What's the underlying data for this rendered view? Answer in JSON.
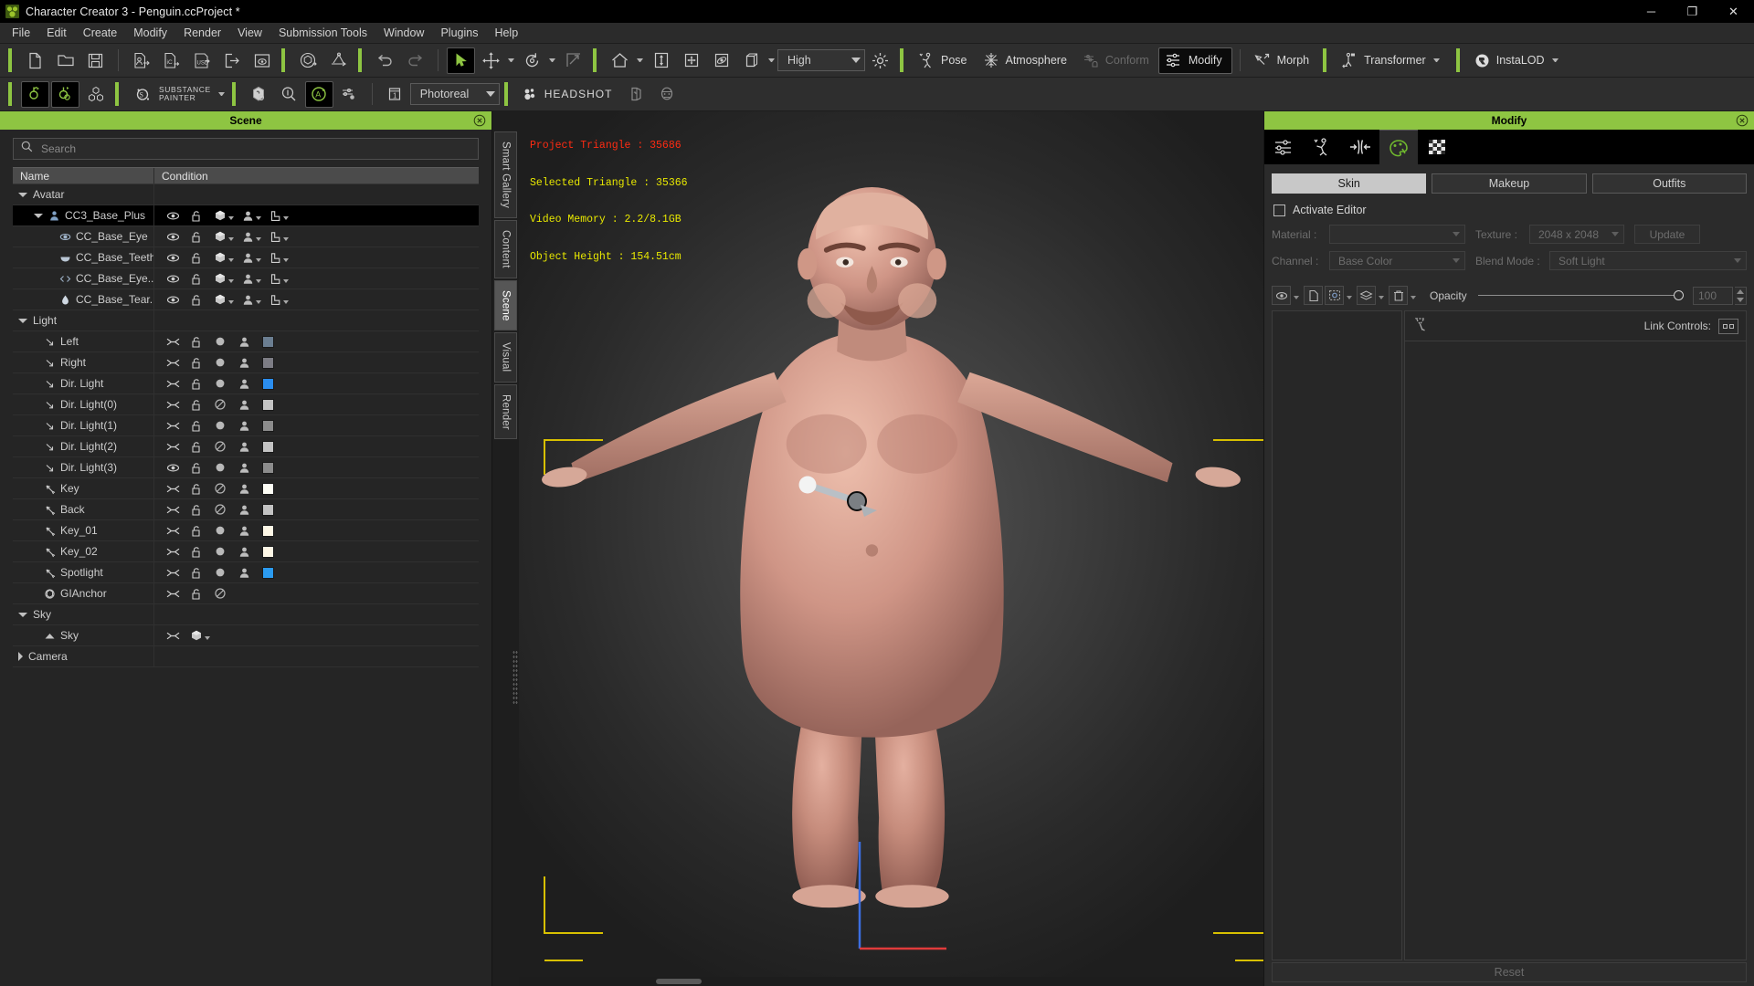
{
  "window": {
    "title": "Character Creator 3 - Penguin.ccProject *",
    "minimize": "─",
    "maximize": "❐",
    "close": "✕"
  },
  "menu": {
    "items": [
      {
        "label": "File"
      },
      {
        "label": "Edit"
      },
      {
        "label": "Create"
      },
      {
        "label": "Modify"
      },
      {
        "label": "Render"
      },
      {
        "label": "View"
      },
      {
        "label": "Submission Tools"
      },
      {
        "label": "Window"
      },
      {
        "label": "Plugins"
      },
      {
        "label": "Help"
      }
    ]
  },
  "toolbar_row1": {
    "quality_select": "High",
    "buttons": [
      {
        "name": "new-project",
        "label": "New Project"
      },
      {
        "name": "open-project",
        "label": "Open Project"
      },
      {
        "name": "save-project",
        "label": "Save Project"
      },
      {
        "name": "import-character",
        "label": "Import Character"
      },
      {
        "name": "import-iclone",
        "label": "Import iClone"
      },
      {
        "name": "import-usd",
        "label": "Import USD"
      },
      {
        "name": "export",
        "label": "Export"
      },
      {
        "name": "render-image",
        "label": "Render Image"
      },
      {
        "name": "reset-selected",
        "label": "Reset Selected"
      },
      {
        "name": "pivot-to-ground",
        "label": "Pivot To Ground"
      },
      {
        "name": "undo",
        "label": "Undo"
      },
      {
        "name": "redo",
        "label": "Redo"
      },
      {
        "name": "select-tool",
        "label": "Select"
      },
      {
        "name": "move-tool",
        "label": "Move"
      },
      {
        "name": "rotate-tool",
        "label": "Rotate"
      },
      {
        "name": "scale-tool",
        "label": "Scale"
      },
      {
        "name": "home-view",
        "label": "Home View"
      },
      {
        "name": "fit-vertical",
        "label": "Fit Vertical"
      },
      {
        "name": "fit-all",
        "label": "Fit All"
      },
      {
        "name": "orbit-view",
        "label": "Orbit View"
      },
      {
        "name": "shading-mode",
        "label": "Shading Mode"
      },
      {
        "name": "lighting-toggle",
        "label": "Lighting"
      }
    ],
    "mode_buttons": [
      {
        "name": "pose",
        "label": "Pose",
        "state": "normal"
      },
      {
        "name": "atmosphere",
        "label": "Atmosphere",
        "state": "normal"
      },
      {
        "name": "conform",
        "label": "Conform",
        "state": "disabled"
      },
      {
        "name": "modify",
        "label": "Modify",
        "state": "active"
      },
      {
        "name": "morph",
        "label": "Morph",
        "state": "normal"
      },
      {
        "name": "transformer",
        "label": "Transformer",
        "state": "normal"
      },
      {
        "name": "instalod",
        "label": "InstaLOD",
        "state": "normal"
      }
    ]
  },
  "toolbar_row2": {
    "substance_line1": "SUBSTANCE",
    "substance_line2": "PAINTER",
    "render_preset": "Photoreal",
    "headshot_label": "HEADSHOT",
    "buttons": [
      {
        "name": "edit-motion",
        "label": "Edit Motion"
      },
      {
        "name": "edit-pose",
        "label": "Edit Pose"
      },
      {
        "name": "mesh-tools",
        "label": "Mesh Tools"
      },
      {
        "name": "mesh-preview",
        "label": "Mesh Preview"
      },
      {
        "name": "zoom-inspect",
        "label": "Zoom Inspect"
      },
      {
        "name": "auto-update",
        "label": "Auto Update"
      },
      {
        "name": "render-settings",
        "label": "Render Settings"
      },
      {
        "name": "one-frame",
        "label": "Single Frame"
      },
      {
        "name": "headshot-plugin",
        "label": "Headshot"
      },
      {
        "name": "headshot-mesh",
        "label": "Headshot Mesh"
      },
      {
        "name": "headshot-face",
        "label": "Headshot Face"
      }
    ]
  },
  "scene_panel": {
    "title": "Scene",
    "search_placeholder": "Search",
    "columns": [
      "Name",
      "Condition"
    ],
    "tree": [
      {
        "label": "Avatar",
        "indent": 0,
        "expander": "down",
        "icon": "",
        "kind": "group",
        "selected": false,
        "cond": "none"
      },
      {
        "label": "CC3_Base_Plus",
        "indent": 1,
        "expander": "down",
        "icon": "person",
        "kind": "item",
        "selected": true,
        "cond": "mesh",
        "eye": "visible",
        "lock": "unlocked"
      },
      {
        "label": "CC_Base_Eye",
        "indent": 2,
        "expander": "",
        "icon": "eye",
        "kind": "item",
        "selected": false,
        "cond": "mesh",
        "eye": "visible",
        "lock": "unlocked"
      },
      {
        "label": "CC_Base_Teeth",
        "indent": 2,
        "expander": "",
        "icon": "teeth",
        "kind": "item",
        "selected": false,
        "cond": "mesh",
        "eye": "visible",
        "lock": "unlocked"
      },
      {
        "label": "CC_Base_Eye...",
        "indent": 2,
        "expander": "",
        "icon": "lashes",
        "kind": "item",
        "selected": false,
        "cond": "mesh",
        "eye": "visible",
        "lock": "unlocked"
      },
      {
        "label": "CC_Base_Tear...",
        "indent": 2,
        "expander": "",
        "icon": "tear",
        "kind": "item",
        "selected": false,
        "cond": "mesh",
        "eye": "visible",
        "lock": "unlocked"
      },
      {
        "label": "Light",
        "indent": 0,
        "expander": "down",
        "icon": "",
        "kind": "group",
        "selected": false,
        "cond": "none"
      },
      {
        "label": "Left",
        "indent": 1,
        "expander": "",
        "icon": "dirlight",
        "kind": "light",
        "selected": false,
        "cond": "light",
        "eye": "hidden",
        "lock": "unlocked",
        "shadow": "on",
        "ambient": "on",
        "color": "#6b7e91"
      },
      {
        "label": "Right",
        "indent": 1,
        "expander": "",
        "icon": "dirlight",
        "kind": "light",
        "selected": false,
        "cond": "light",
        "eye": "hidden",
        "lock": "unlocked",
        "shadow": "on",
        "ambient": "on",
        "color": "#7d7d85"
      },
      {
        "label": "Dir. Light",
        "indent": 1,
        "expander": "",
        "icon": "dirlight",
        "kind": "light",
        "selected": false,
        "cond": "light",
        "eye": "hidden",
        "lock": "unlocked",
        "shadow": "on",
        "ambient": "on",
        "color": "#2b8ef0"
      },
      {
        "label": "Dir. Light(0)",
        "indent": 1,
        "expander": "",
        "icon": "dirlight",
        "kind": "light",
        "selected": false,
        "cond": "light",
        "eye": "hidden",
        "lock": "unlocked",
        "shadow": "off",
        "ambient": "on",
        "color": "#c3c3c3"
      },
      {
        "label": "Dir. Light(1)",
        "indent": 1,
        "expander": "",
        "icon": "dirlight",
        "kind": "light",
        "selected": false,
        "cond": "light",
        "eye": "hidden",
        "lock": "unlocked",
        "shadow": "on",
        "ambient": "on",
        "color": "#8c8c8c"
      },
      {
        "label": "Dir. Light(2)",
        "indent": 1,
        "expander": "",
        "icon": "dirlight",
        "kind": "light",
        "selected": false,
        "cond": "light",
        "eye": "hidden",
        "lock": "unlocked",
        "shadow": "off",
        "ambient": "dim",
        "color": "#c3c3c3"
      },
      {
        "label": "Dir. Light(3)",
        "indent": 1,
        "expander": "",
        "icon": "dirlight",
        "kind": "light",
        "selected": false,
        "cond": "light",
        "eye": "visible",
        "lock": "unlocked",
        "shadow": "on",
        "ambient": "on",
        "color": "#8c8c8c"
      },
      {
        "label": "Key",
        "indent": 1,
        "expander": "",
        "icon": "spotlight",
        "kind": "light",
        "selected": false,
        "cond": "light",
        "eye": "hidden",
        "lock": "unlocked",
        "shadow": "off",
        "ambient": "on",
        "color": "#fdfdf5"
      },
      {
        "label": "Back",
        "indent": 1,
        "expander": "",
        "icon": "spotlight",
        "kind": "light",
        "selected": false,
        "cond": "light",
        "eye": "hidden",
        "lock": "unlocked",
        "shadow": "off",
        "ambient": "on",
        "color": "#c3c3c3"
      },
      {
        "label": "Key_01",
        "indent": 1,
        "expander": "",
        "icon": "spotlight",
        "kind": "light",
        "selected": false,
        "cond": "light",
        "eye": "hidden",
        "lock": "unlocked",
        "shadow": "on",
        "ambient": "on",
        "color": "#fdf7e6"
      },
      {
        "label": "Key_02",
        "indent": 1,
        "expander": "",
        "icon": "spotlight",
        "kind": "light",
        "selected": false,
        "cond": "light",
        "eye": "hidden",
        "lock": "unlocked",
        "shadow": "on",
        "ambient": "on",
        "color": "#fdf7e6"
      },
      {
        "label": "Spotlight",
        "indent": 1,
        "expander": "",
        "icon": "spotlight",
        "kind": "light",
        "selected": false,
        "cond": "light",
        "eye": "hidden",
        "lock": "unlocked",
        "shadow": "on",
        "ambient": "on",
        "color": "#2b9bf0"
      },
      {
        "label": "GIAnchor",
        "indent": 1,
        "expander": "",
        "icon": "anchor",
        "kind": "anchor",
        "selected": false,
        "cond": "anchor",
        "eye": "hidden",
        "lock": "unlocked",
        "shadow": "off"
      },
      {
        "label": "Sky",
        "indent": 0,
        "expander": "down",
        "icon": "",
        "kind": "group",
        "selected": false,
        "cond": "none"
      },
      {
        "label": "Sky",
        "indent": 1,
        "expander": "",
        "icon": "sky",
        "kind": "sky",
        "selected": false,
        "cond": "sky",
        "eye": "hidden"
      },
      {
        "label": "Camera",
        "indent": 0,
        "expander": "right",
        "icon": "",
        "kind": "group",
        "selected": false,
        "cond": "none"
      }
    ]
  },
  "vertical_tabs": [
    {
      "label": "Smart Gallery",
      "active": false
    },
    {
      "label": "Content",
      "active": false
    },
    {
      "label": "Scene",
      "active": true
    },
    {
      "label": "Visual",
      "active": false
    },
    {
      "label": "Render",
      "active": false
    }
  ],
  "viewport": {
    "stats": [
      {
        "text": "Project Triangle : 35686",
        "color": "#ff2b12"
      },
      {
        "text": "Selected Triangle : 35366",
        "color": "#e8e800"
      },
      {
        "text": "Video Memory : 2.2/8.1GB",
        "color": "#e8e800"
      },
      {
        "text": "Object Height : 154.51cm",
        "color": "#e8e800"
      }
    ],
    "project_triangle": 35686,
    "selected_triangle": 35366,
    "video_memory_used_gb": 2.2,
    "video_memory_total_gb": 8.1,
    "object_height_cm": 154.51
  },
  "modify_panel": {
    "title": "Modify",
    "tabs": [
      {
        "name": "attribute-tab",
        "active": false
      },
      {
        "name": "pose-tab",
        "active": false
      },
      {
        "name": "adjust-tab",
        "active": false
      },
      {
        "name": "material-tab",
        "active": true
      },
      {
        "name": "texture-tab",
        "active": false
      }
    ],
    "segments": [
      {
        "label": "Skin",
        "active": true
      },
      {
        "label": "Makeup",
        "active": false
      },
      {
        "label": "Outfits",
        "active": false
      }
    ],
    "activate_editor": {
      "label": "Activate Editor",
      "checked": false
    },
    "fields": {
      "material_label": "Material :",
      "material_value": "",
      "texture_label": "Texture :",
      "texture_value": "2048 x 2048",
      "update_label": "Update",
      "channel_label": "Channel :",
      "channel_value": "Base Color",
      "blend_mode_label": "Blend Mode :",
      "blend_mode_value": "Soft Light"
    },
    "opacity": {
      "label": "Opacity",
      "value": "100",
      "percent": 100
    },
    "link_controls_label": "Link Controls:",
    "reset_label": "Reset",
    "layer_tools": [
      {
        "name": "layer-visibility",
        "label": "Visibility"
      },
      {
        "name": "layer-duplicate",
        "label": "Duplicate"
      },
      {
        "name": "layer-select",
        "label": "Select"
      },
      {
        "name": "layer-merge",
        "label": "Merge"
      },
      {
        "name": "layer-delete",
        "label": "Delete"
      }
    ]
  },
  "colors": {
    "accent_green": "#8ec542",
    "panel_bg": "#2b2b2b",
    "toolbar_bg": "#2e2e2e",
    "selected_row": "#000000",
    "stat_red": "#ff2b12",
    "stat_yellow": "#e8e800",
    "gizmo_blue": "#3b6ee0",
    "gizmo_red": "#e03b3b",
    "viewport_corner": "#d8c000"
  }
}
